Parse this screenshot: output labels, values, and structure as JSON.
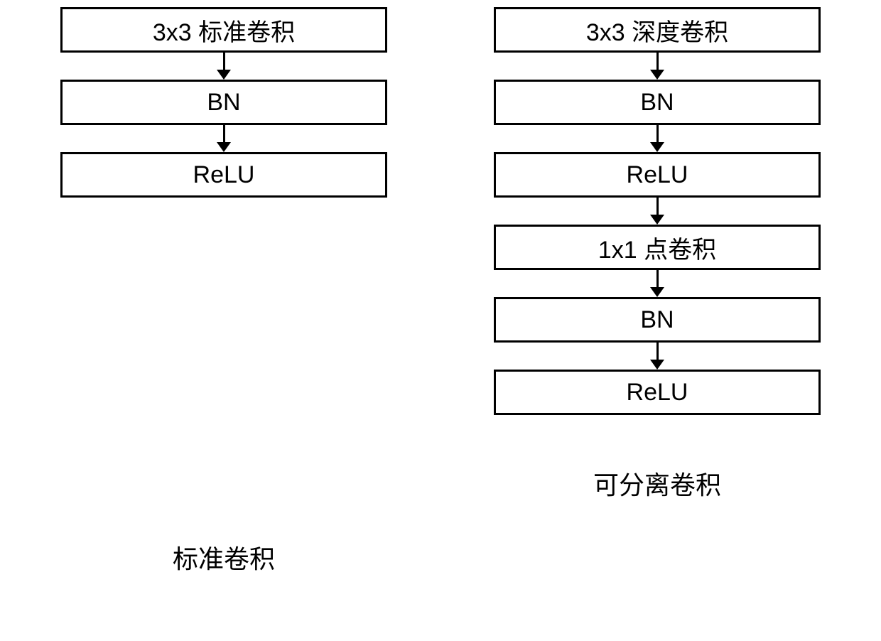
{
  "left": {
    "caption": "标准卷积",
    "boxes": [
      "3x3 标准卷积",
      "BN",
      "ReLU"
    ]
  },
  "right": {
    "caption": "可分离卷积",
    "boxes": [
      "3x3 深度卷积",
      "BN",
      "ReLU",
      "1x1 点卷积",
      "BN",
      "ReLU"
    ]
  }
}
